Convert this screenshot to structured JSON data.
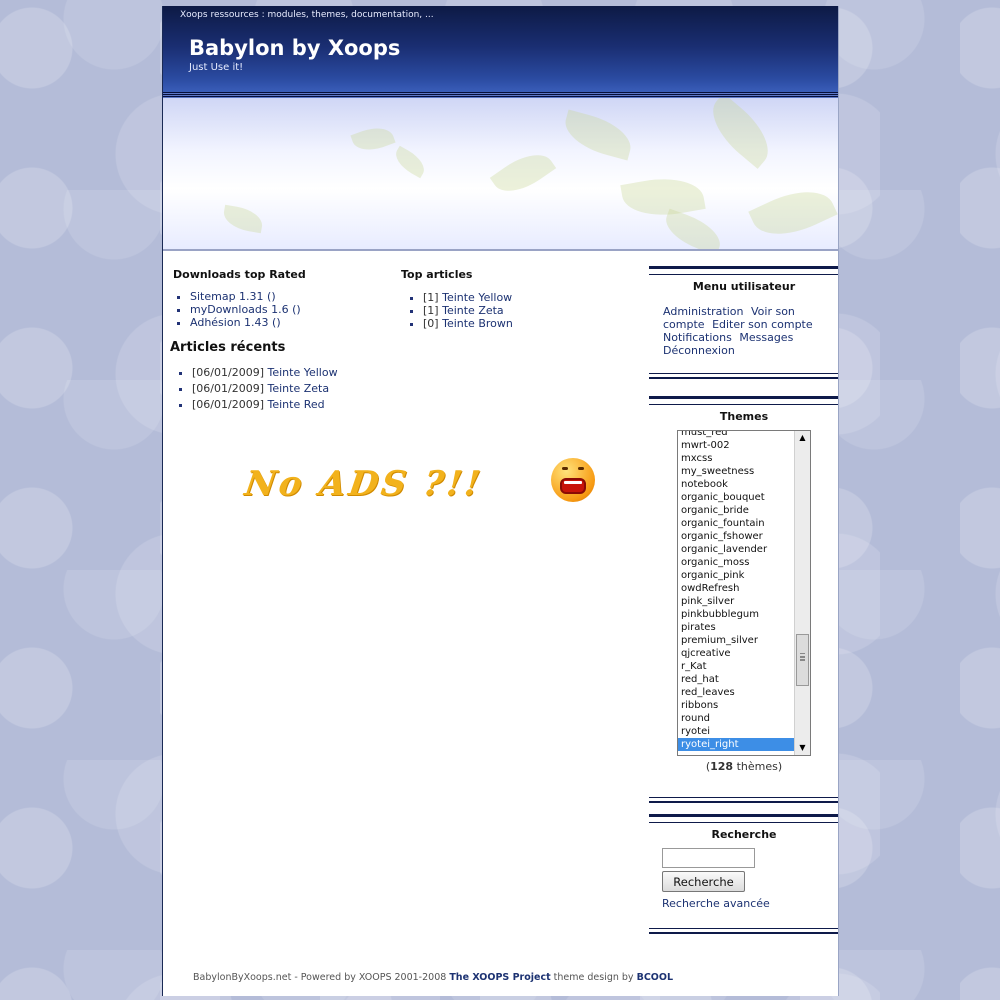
{
  "header": {
    "topline": "Xoops ressources : modules, themes, documentation, ...",
    "title": "Babylon by Xoops",
    "slogan": "Just Use it!"
  },
  "downloads_top": {
    "title": "Downloads top Rated",
    "items": [
      "Sitemap 1.31 ()",
      "myDownloads 1.6 ()",
      "Adhésion 1.43 ()"
    ]
  },
  "recent_articles": {
    "title": "Articles récents",
    "items": [
      {
        "date": "[06/01/2009]",
        "link": "Teinte Yellow"
      },
      {
        "date": "[06/01/2009]",
        "link": "Teinte Zeta"
      },
      {
        "date": "[06/01/2009]",
        "link": "Teinte Red"
      }
    ]
  },
  "top_articles": {
    "title": "Top articles",
    "items": [
      {
        "count": "[1]",
        "link": "Teinte Yellow"
      },
      {
        "count": "[1]",
        "link": "Teinte Zeta"
      },
      {
        "count": "[0]",
        "link": "Teinte Brown"
      }
    ]
  },
  "noads": {
    "text": "No ADS ?!!"
  },
  "user_menu": {
    "title": "Menu utilisateur",
    "links": [
      "Administration",
      "Voir son compte",
      "Editer son compte",
      "Notifications",
      "Messages",
      "Déconnexion"
    ]
  },
  "themes": {
    "title": "Themes",
    "options": [
      "must_red",
      "mwrt-002",
      "mxcss",
      "my_sweetness",
      "notebook",
      "organic_bouquet",
      "organic_bride",
      "organic_fountain",
      "organic_fshower",
      "organic_lavender",
      "organic_moss",
      "organic_pink",
      "owdRefresh",
      "pink_silver",
      "pinkbubblegum",
      "pirates",
      "premium_silver",
      "qjcreative",
      "r_Kat",
      "red_hat",
      "red_leaves",
      "ribbons",
      "round",
      "ryotei",
      "ryotei_right"
    ],
    "selected": "ryotei_right",
    "count": "128",
    "count_suffix": "thèmes"
  },
  "search": {
    "title": "Recherche",
    "button": "Recherche",
    "advanced": "Recherche avancée",
    "value": ""
  },
  "footer": {
    "prefix": "BabylonByXoops.net - Powered by XOOPS 2001-2008",
    "project": "The XOOPS Project",
    "middle": "theme design by",
    "designer": "BCOOL"
  }
}
